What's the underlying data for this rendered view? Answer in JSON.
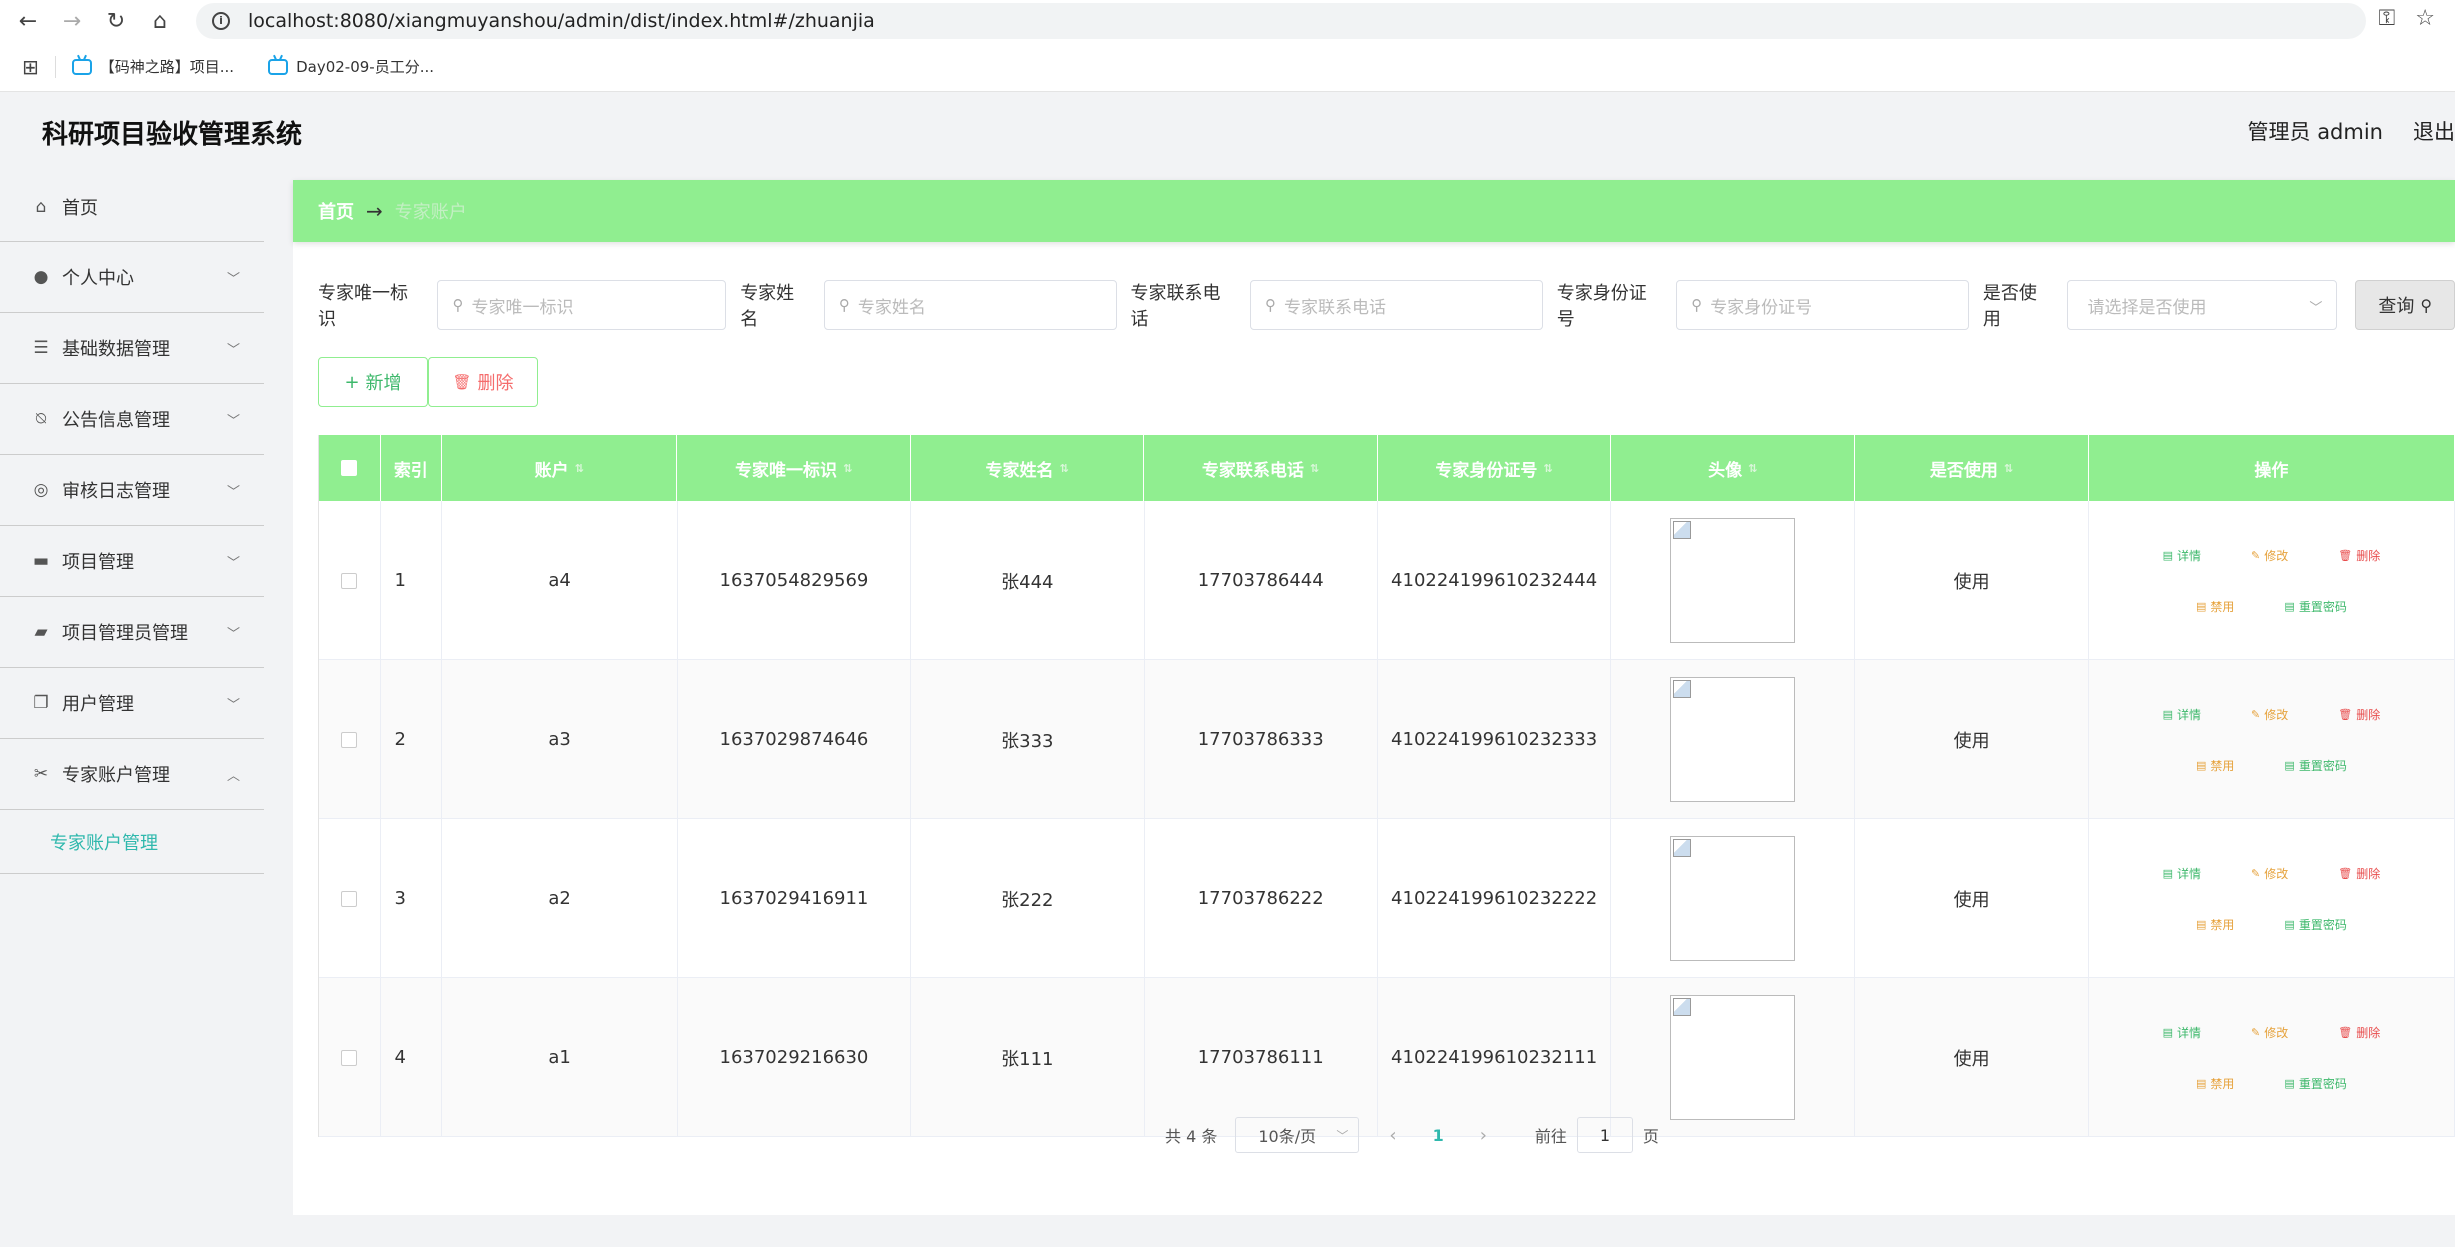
{
  "browser": {
    "url_host": "localhost",
    "url_rest": ":8080/xiangmuyanshou/admin/dist/index.html#/zhuanjia",
    "bookmarks": [
      {
        "label": "【码神之路】项目..."
      },
      {
        "label": "Day02-09-员工分..."
      }
    ]
  },
  "app": {
    "title": "科研项目验收管理系统",
    "user_label": "管理员 admin",
    "logout_label": "退出"
  },
  "sidebar": {
    "items": [
      {
        "label": "首页",
        "icon": "home-icon"
      },
      {
        "label": "个人中心",
        "icon": "user-icon"
      },
      {
        "label": "基础数据管理",
        "icon": "list-icon"
      },
      {
        "label": "公告信息管理",
        "icon": "bell-off-icon"
      },
      {
        "label": "审核日志管理",
        "icon": "compass-icon"
      },
      {
        "label": "项目管理",
        "icon": "briefcase-icon"
      },
      {
        "label": "项目管理员管理",
        "icon": "wallet-icon"
      },
      {
        "label": "用户管理",
        "icon": "copy-icon"
      },
      {
        "label": "专家账户管理",
        "icon": "ticket-icon"
      }
    ],
    "sub_item": "专家账户管理"
  },
  "breadcrumb": {
    "home": "首页",
    "current": "专家账户"
  },
  "search": {
    "fields": [
      {
        "label": "专家唯一标识",
        "placeholder": "专家唯一标识"
      },
      {
        "label": "专家姓名",
        "placeholder": "专家姓名"
      },
      {
        "label": "专家联系电话",
        "placeholder": "专家联系电话"
      },
      {
        "label": "专家身份证号",
        "placeholder": "专家身份证号"
      }
    ],
    "select_label": "是否使用",
    "select_placeholder": "请选择是否使用",
    "query_label": "查询"
  },
  "actions": {
    "add_label": "新增",
    "delete_label": "删除"
  },
  "table": {
    "headers": {
      "index": "索引",
      "account": "账户",
      "uid": "专家唯一标识",
      "name": "专家姓名",
      "phone": "专家联系电话",
      "idcard": "专家身份证号",
      "avatar": "头像",
      "in_use": "是否使用",
      "ops": "操作"
    },
    "rows": [
      {
        "index": "1",
        "account": "a4",
        "uid": "1637054829569",
        "name": "张444",
        "phone": "17703786444",
        "idcard": "410224199610232444",
        "in_use": "使用"
      },
      {
        "index": "2",
        "account": "a3",
        "uid": "1637029874646",
        "name": "张333",
        "phone": "17703786333",
        "idcard": "410224199610232333",
        "in_use": "使用"
      },
      {
        "index": "3",
        "account": "a2",
        "uid": "1637029416911",
        "name": "张222",
        "phone": "17703786222",
        "idcard": "410224199610232222",
        "in_use": "使用"
      },
      {
        "index": "4",
        "account": "a1",
        "uid": "1637029216630",
        "name": "张111",
        "phone": "17703786111",
        "idcard": "410224199610232111",
        "in_use": "使用"
      }
    ],
    "ops": {
      "detail": "详情",
      "edit": "修改",
      "remove": "删除",
      "disable": "禁用",
      "reset": "重置密码"
    }
  },
  "pagination": {
    "total": "共 4 条",
    "page_size": "10条/页",
    "current_page": "1",
    "goto_label": "前往",
    "goto_value": "1",
    "page_suffix": "页"
  },
  "colors": {
    "accent_green": "#90ee90",
    "teal": "#2fb8ad",
    "danger": "#f56c6c",
    "warning": "#e6a23c"
  }
}
